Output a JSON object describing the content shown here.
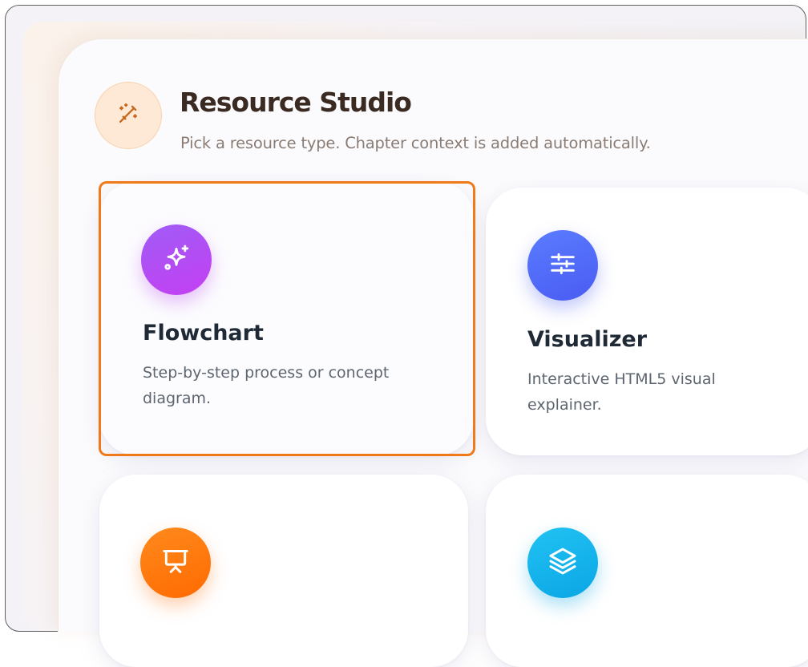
{
  "header": {
    "icon": "magic-wand-icon",
    "title": "Resource Studio",
    "subtitle": "Pick a resource type. Chapter context is added automatically."
  },
  "cards": [
    {
      "title": "Flowchart",
      "description": "Step-by-step process or concept diagram.",
      "icon": "sparkles-icon",
      "accent": "#b24cf4",
      "selected": true
    },
    {
      "title": "Visualizer",
      "description": "Interactive HTML5 visual explainer.",
      "icon": "sliders-icon",
      "accent": "#4f63f6",
      "selected": false
    },
    {
      "icon": "presentation-icon",
      "accent": "#ff7410",
      "selected": false
    },
    {
      "icon": "layers-icon",
      "accent": "#14b0ea",
      "selected": false
    }
  ],
  "colors": {
    "selection_outline": "#f07a1a",
    "title_text": "#3a2a22",
    "header_icon_bg": "#fde9d6"
  }
}
